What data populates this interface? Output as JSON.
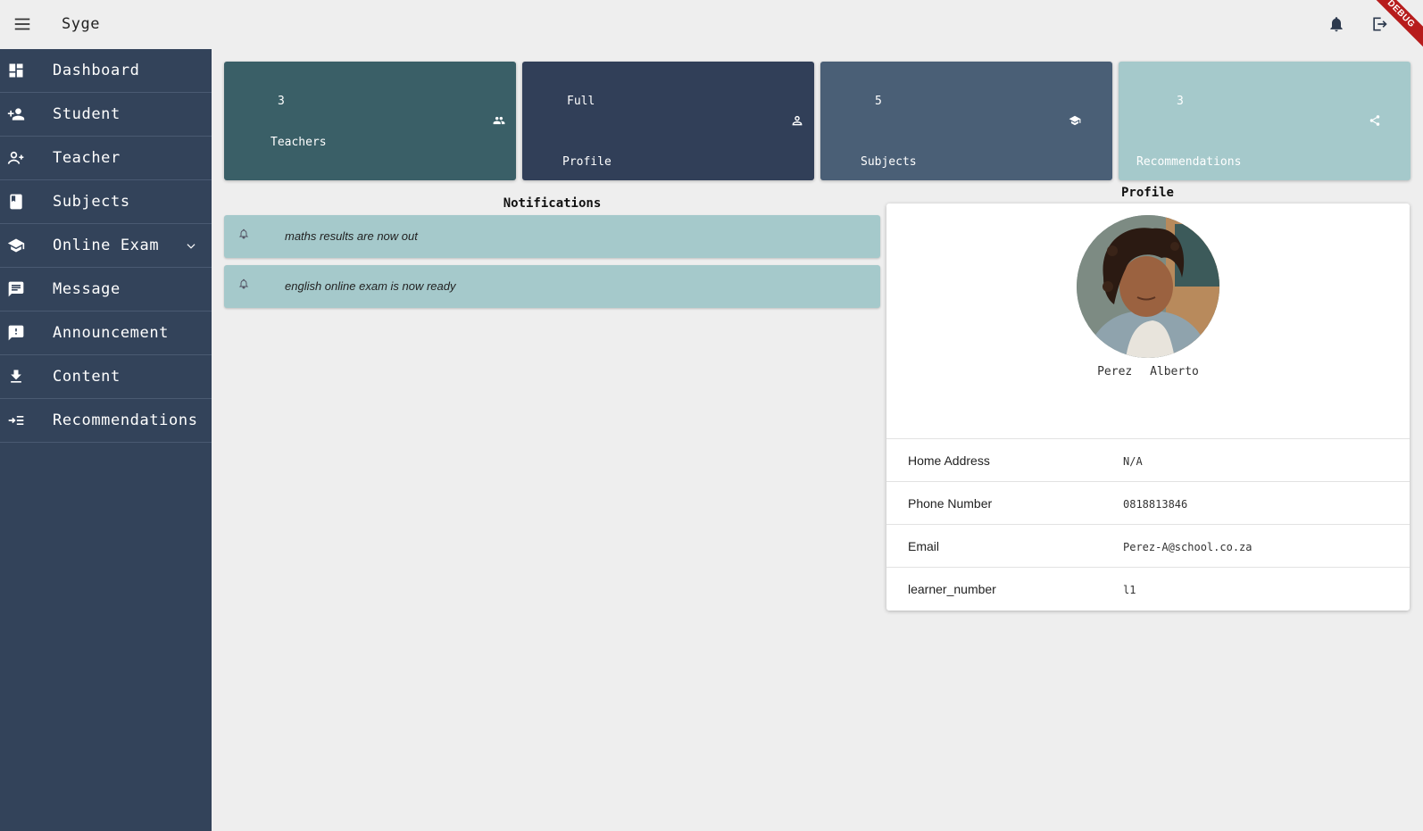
{
  "app": {
    "title": "Syge",
    "debug_label": "DEBUG"
  },
  "appbar": {
    "menu_icon": "menu-icon",
    "actions": [
      {
        "icon": "bell-icon"
      },
      {
        "icon": "logout-icon"
      }
    ]
  },
  "sidebar": {
    "items": [
      {
        "label": "Dashboard",
        "icon": "dashboard-icon"
      },
      {
        "label": "Student",
        "icon": "person-add-icon"
      },
      {
        "label": "Teacher",
        "icon": "person-add-outline-icon"
      },
      {
        "label": "Subjects",
        "icon": "book-icon"
      },
      {
        "label": "Online Exam",
        "icon": "graduation-cap-icon",
        "expandable": true
      },
      {
        "label": "Message",
        "icon": "chat-icon"
      },
      {
        "label": "Announcement",
        "icon": "feedback-icon"
      },
      {
        "label": "Content",
        "icon": "download-icon"
      },
      {
        "label": "Recommendations",
        "icon": "playlist-icon"
      }
    ]
  },
  "stats": [
    {
      "value": "3",
      "label": "Teachers",
      "icon": "group-icon",
      "color": "#3a5f67"
    },
    {
      "value": "Full",
      "label": "Profile",
      "icon": "person-icon",
      "color": "#313f58"
    },
    {
      "value": "5",
      "label": "Subjects",
      "icon": "graduation-cap-icon",
      "color": "#4a5f76"
    },
    {
      "value": "3",
      "label": "Recommendations",
      "icon": "share-icon",
      "color": "#a5c9cb"
    }
  ],
  "notifications": {
    "title": "Notifications",
    "items": [
      {
        "text": "maths results are now out",
        "icon": "alarm-icon"
      },
      {
        "text": "english online exam is now ready",
        "icon": "alarm-icon"
      }
    ]
  },
  "profile": {
    "title": "Profile",
    "first_name": "Perez",
    "last_name": "Alberto",
    "rows": [
      {
        "key": "Home Address",
        "value": "N/A"
      },
      {
        "key": "Phone Number",
        "value": "0818813846"
      },
      {
        "key": "Email",
        "value": "Perez-A@school.co.za"
      },
      {
        "key": "learner_number",
        "value": "l1"
      }
    ]
  },
  "colors": {
    "sidebar": "#33435a",
    "background": "#eeeeee",
    "notification": "#a5c9cb"
  }
}
